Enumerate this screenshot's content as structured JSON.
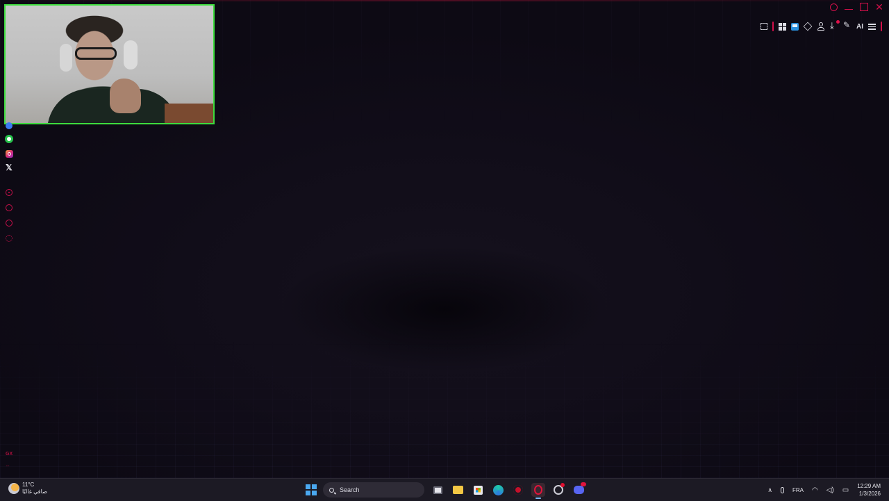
{
  "window": {
    "controls": [
      "search",
      "minimize",
      "maximize",
      "close"
    ],
    "accent_color": "#d3104a"
  },
  "toolbar": {
    "icons": [
      "snapshot-icon",
      "qr-grid-icon",
      "extension-icon",
      "cube-icon",
      "account-icon",
      "download-icon",
      "aria-pen-icon",
      "menu-icon"
    ],
    "ai_label": "AI"
  },
  "webcam": {
    "border_color": "#3ddc3d"
  },
  "sidebar": {
    "items": [
      "messenger-icon",
      "whatsapp-icon",
      "instagram-icon",
      "x-icon",
      "player-icon",
      "history-icon",
      "extensions-icon",
      "settings-icon"
    ],
    "footer_logo": "GX",
    "more": "···"
  },
  "taskbar": {
    "weather": {
      "temperature": "11°C",
      "condition": "صافي غالبًا"
    },
    "search_placeholder": "Search",
    "apps": [
      "start-button",
      "task-view",
      "file-explorer",
      "microsoft-store",
      "edge",
      "red-app",
      "opera-gx",
      "chrome",
      "discord"
    ],
    "tray": {
      "language": "FRA",
      "time": "12:29 AM",
      "date": "1/3/2026"
    }
  }
}
